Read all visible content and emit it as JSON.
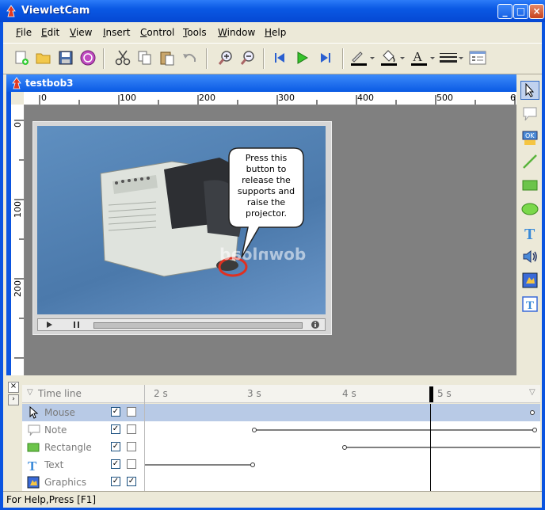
{
  "window": {
    "title": "ViewletCam"
  },
  "menu": [
    "File",
    "Edit",
    "View",
    "Insert",
    "Control",
    "Tools",
    "Window",
    "Help"
  ],
  "menu_mnemonics": [
    "F",
    "E",
    "V",
    "I",
    "C",
    "T",
    "W",
    "H"
  ],
  "document": {
    "title": "testbob3"
  },
  "ruler": {
    "h_labels": [
      "0",
      "100",
      "200",
      "300",
      "400",
      "500",
      "6"
    ],
    "v_labels": [
      "0",
      "100",
      "200"
    ]
  },
  "callout": {
    "text": "Press this button to release the supports and raise the projector."
  },
  "watermark": "download",
  "timeline": {
    "header": "Time line",
    "ticks": [
      "2 s",
      "3 s",
      "4 s",
      "5 s"
    ],
    "rows": [
      {
        "name": "Mouse",
        "visible": true,
        "locked": false
      },
      {
        "name": "Note",
        "visible": true,
        "locked": false
      },
      {
        "name": "Rectangle",
        "visible": true,
        "locked": false
      },
      {
        "name": "Text",
        "visible": true,
        "locked": false
      },
      {
        "name": "Graphics",
        "visible": true,
        "locked": true
      }
    ]
  },
  "status": {
    "text": "For Help,Press [F1]"
  },
  "colors": {
    "title_blue": "#0a54e0",
    "accent_red": "#e03020",
    "track_blue": "#b8cae6"
  }
}
